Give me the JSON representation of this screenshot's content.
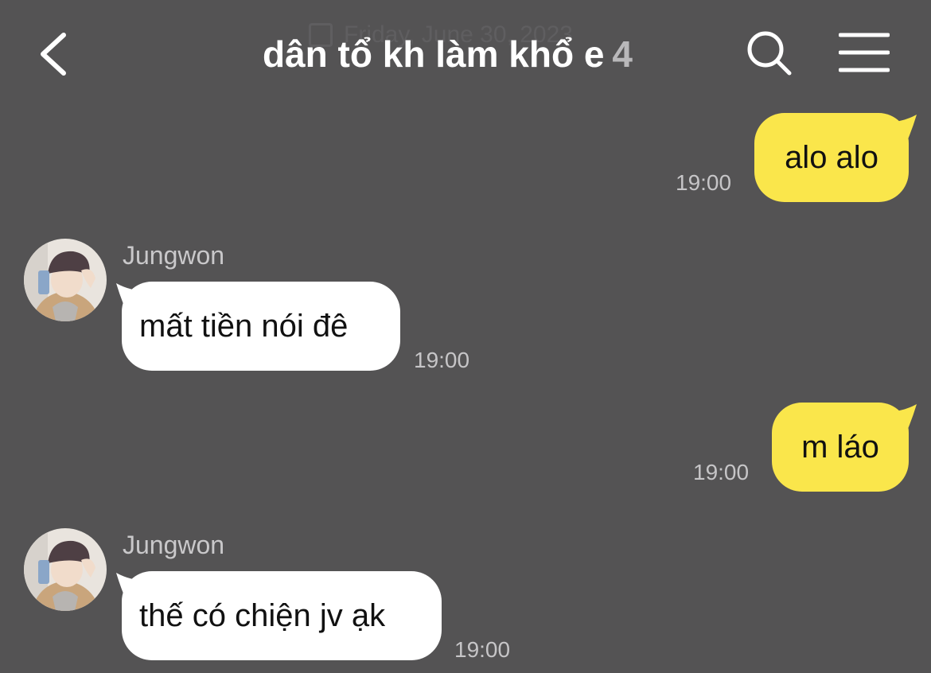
{
  "header": {
    "date": "Friday, June 30, 2023",
    "title": "dân tổ kh làm khổ e",
    "member_count": "4"
  },
  "messages": [
    {
      "sender": "me",
      "text": "alo alo",
      "time": "19:00"
    },
    {
      "sender": "Jungwon",
      "text": "mất tiền nói đê",
      "time": "19:00"
    },
    {
      "sender": "me",
      "text": "m láo",
      "time": "19:00"
    },
    {
      "sender": "Jungwon",
      "text": "thế có chiện jv ạk",
      "time": "19:00"
    }
  ],
  "colors": {
    "background": "#545354",
    "my_bubble": "#fae64b",
    "their_bubble": "#ffffff",
    "time_text": "#c6c5c7"
  },
  "icons": {
    "back": "chevron-left-icon",
    "search": "search-icon",
    "menu": "hamburger-menu-icon"
  }
}
